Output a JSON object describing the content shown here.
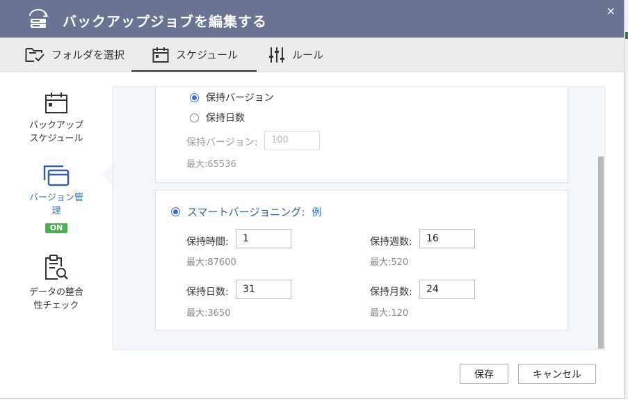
{
  "window": {
    "title": "バックアップジョブを編集する",
    "close_glyph": "×"
  },
  "tabs": [
    {
      "label": "フォルダを選択",
      "icon": "folder-check-icon"
    },
    {
      "label": "スケジュール",
      "icon": "calendar-icon"
    },
    {
      "label": "ルール",
      "icon": "sliders-icon"
    }
  ],
  "sidebar": {
    "items": [
      {
        "label_line1": "バックアップ",
        "label_line2": "スケジュール",
        "icon": "calendar-icon"
      },
      {
        "label_line1": "バージョン管",
        "label_line2": "理",
        "badge": "ON",
        "icon": "versions-icon"
      },
      {
        "label_line1": "データの整合",
        "label_line2": "性チェック",
        "icon": "clipboard-search-icon"
      }
    ]
  },
  "versioning": {
    "option_keep_versions": "保持バージョン",
    "option_keep_days": "保持日数",
    "keep_versions_label": "保持バージョン:",
    "keep_versions_placeholder": "100",
    "keep_versions_max": "最大:65536",
    "smart_label": "スマートバージョニング:",
    "smart_example": "例",
    "fields": {
      "hours": {
        "label": "保持時間:",
        "value": "1",
        "max": "最大:87600"
      },
      "weeks": {
        "label": "保持週数:",
        "value": "16",
        "max": "最大:520"
      },
      "days": {
        "label": "保持日数:",
        "value": "31",
        "max": "最大:3650"
      },
      "months": {
        "label": "保持月数:",
        "value": "24",
        "max": "最大:120"
      }
    }
  },
  "footer": {
    "save_label": "保存",
    "cancel_label": "キャンセル"
  },
  "colors": {
    "titlebar": "#6b7392",
    "accent": "#3a6fd8",
    "badge": "#4caf50"
  }
}
